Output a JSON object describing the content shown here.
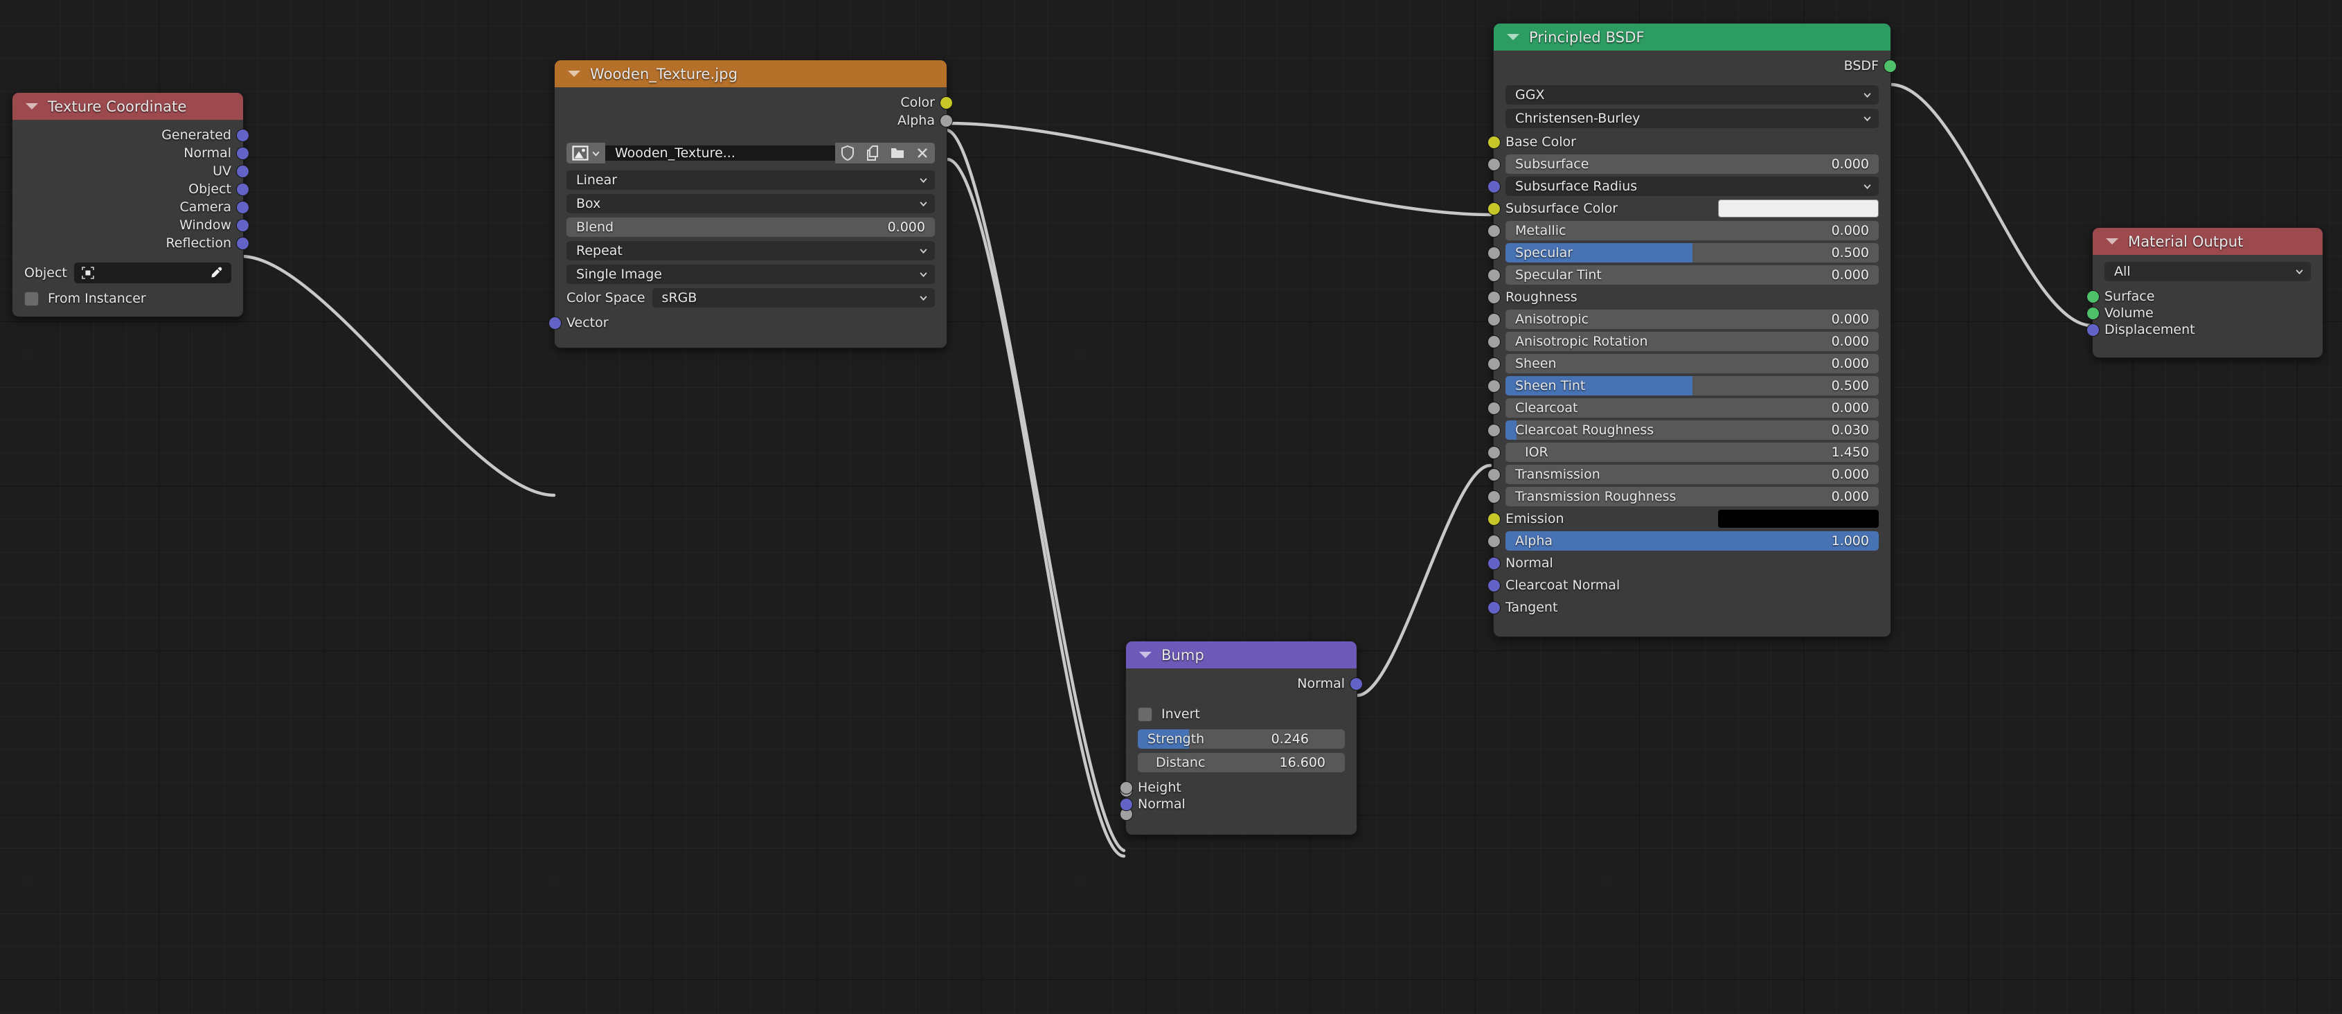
{
  "editor": {
    "name": "blender-shader-node-editor",
    "background": "#1d1d1d"
  },
  "colors": {
    "header_input": "#9c4a4e",
    "header_texture": "#b5702a",
    "header_shader": "#2d9c62",
    "header_vector": "#6d5ab8",
    "header_output": "#9c4a4e",
    "socket_vector": "#6363c7",
    "socket_color": "#c7c729",
    "socket_value": "#a1a1a1",
    "socket_shader": "#4fc16b",
    "slider_fill": "#4772b3",
    "link": "#c8c8c8"
  },
  "nodes": {
    "texture_coordinate": {
      "title": "Texture Coordinate",
      "outputs": [
        "Generated",
        "Normal",
        "UV",
        "Object",
        "Camera",
        "Window",
        "Reflection"
      ],
      "object_label": "Object",
      "object_value": "",
      "from_instancer_label": "From Instancer",
      "from_instancer_checked": false
    },
    "image_texture": {
      "title": "Wooden_Texture.jpg",
      "outputs": [
        "Color",
        "Alpha"
      ],
      "datablock_name": "Wooden_Texture...",
      "datablock_buttons": [
        "shield-icon",
        "copy-icon",
        "folder-icon",
        "close-icon"
      ],
      "interpolation": "Linear",
      "projection": "Box",
      "blend_label": "Blend",
      "blend_value": "0.000",
      "blend_fill_pct": 0,
      "extension": "Repeat",
      "source": "Single Image",
      "color_space_label": "Color Space",
      "color_space_value": "sRGB",
      "inputs": [
        "Vector"
      ]
    },
    "bump": {
      "title": "Bump",
      "outputs": [
        "Normal"
      ],
      "invert_label": "Invert",
      "invert_checked": false,
      "strength_label": "Strength",
      "strength_value": "0.246",
      "strength_fill_pct": 24.6,
      "distance_label": "Distanc",
      "distance_value": "16.600",
      "distance_fill_pct": 0,
      "inputs": [
        "Height",
        "Normal"
      ]
    },
    "principled_bsdf": {
      "title": "Principled BSDF",
      "outputs": [
        "BSDF"
      ],
      "distribution": "GGX",
      "subsurface_method": "Christensen-Burley",
      "rows": [
        {
          "label": "Base Color",
          "type": "socket",
          "socket": "col"
        },
        {
          "label": "Subsurface",
          "type": "slider",
          "value": "0.000",
          "fill": 0,
          "socket": "val"
        },
        {
          "label": "Subsurface Radius",
          "type": "dropdown",
          "socket": "vec"
        },
        {
          "label": "Subsurface Color",
          "type": "swatch",
          "color": "#eeeeee",
          "socket": "col"
        },
        {
          "label": "Metallic",
          "type": "slider",
          "value": "0.000",
          "fill": 0,
          "socket": "val"
        },
        {
          "label": "Specular",
          "type": "slider",
          "value": "0.500",
          "fill": 50,
          "socket": "val"
        },
        {
          "label": "Specular Tint",
          "type": "slider",
          "value": "0.000",
          "fill": 0,
          "socket": "val"
        },
        {
          "label": "Roughness",
          "type": "socket",
          "socket": "val"
        },
        {
          "label": "Anisotropic",
          "type": "slider",
          "value": "0.000",
          "fill": 0,
          "socket": "val"
        },
        {
          "label": "Anisotropic Rotation",
          "type": "slider",
          "value": "0.000",
          "fill": 0,
          "socket": "val"
        },
        {
          "label": "Sheen",
          "type": "slider",
          "value": "0.000",
          "fill": 0,
          "socket": "val"
        },
        {
          "label": "Sheen Tint",
          "type": "slider",
          "value": "0.500",
          "fill": 50,
          "socket": "val"
        },
        {
          "label": "Clearcoat",
          "type": "slider",
          "value": "0.000",
          "fill": 0,
          "socket": "val"
        },
        {
          "label": "Clearcoat Roughness",
          "type": "slider",
          "value": "0.030",
          "fill": 3,
          "socket": "val"
        },
        {
          "label": "IOR",
          "type": "slider",
          "value": "1.450",
          "fill": 0,
          "socket": "val",
          "center": true
        },
        {
          "label": "Transmission",
          "type": "slider",
          "value": "0.000",
          "fill": 0,
          "socket": "val"
        },
        {
          "label": "Transmission Roughness",
          "type": "slider",
          "value": "0.000",
          "fill": 0,
          "socket": "val"
        },
        {
          "label": "Emission",
          "type": "swatch",
          "color": "#000000",
          "socket": "col"
        },
        {
          "label": "Alpha",
          "type": "slider",
          "value": "1.000",
          "fill": 100,
          "socket": "val"
        },
        {
          "label": "Normal",
          "type": "socket",
          "socket": "vec"
        },
        {
          "label": "Clearcoat Normal",
          "type": "socket",
          "socket": "vec"
        },
        {
          "label": "Tangent",
          "type": "socket",
          "socket": "vec"
        }
      ]
    },
    "material_output": {
      "title": "Material Output",
      "target": "All",
      "inputs": [
        "Surface",
        "Volume",
        "Displacement"
      ]
    }
  },
  "links": [
    {
      "from": "texture_coordinate.Object",
      "to": "image_texture.Vector"
    },
    {
      "from": "image_texture.Color",
      "to": "principled_bsdf.Base Color"
    },
    {
      "from": "image_texture.Alpha",
      "to": "bump.Height"
    },
    {
      "from": "image_texture.Color",
      "to": "bump.Height"
    },
    {
      "from": "bump.Normal",
      "to": "principled_bsdf.Roughness"
    },
    {
      "from": "principled_bsdf.BSDF",
      "to": "material_output.Surface"
    }
  ]
}
